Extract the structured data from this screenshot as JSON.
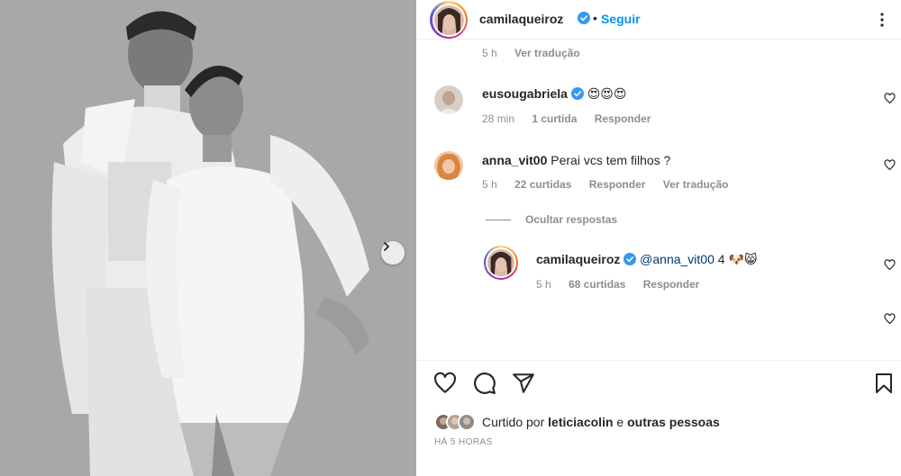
{
  "post": {
    "username": "camilaqueiroz",
    "separator": "•",
    "follow_label": "Seguir"
  },
  "comments": {
    "top_meta": {
      "time": "5 h",
      "translate": "Ver tradução"
    },
    "items": [
      {
        "username": "eusougabriela",
        "text": "😍😍😍",
        "time": "28 min",
        "likes": "1 curtida",
        "reply": "Responder"
      },
      {
        "username": "anna_vit00",
        "text": "Perai vcs tem filhos ?",
        "time": "5 h",
        "likes": "22 curtidas",
        "reply": "Responder",
        "translate": "Ver tradução",
        "hide_replies": "Ocultar respostas",
        "reply_item": {
          "username": "camilaqueiroz",
          "mention": "@anna_vit00",
          "text": "4 🐶😸",
          "time": "5 h",
          "likes": "68 curtidas",
          "reply": "Responder"
        }
      }
    ]
  },
  "footer": {
    "liked_by_prefix": "Curtido por",
    "liked_by_user": "leticiacolin",
    "liked_by_and": "e",
    "liked_by_others": "outras pessoas",
    "time_ago": "HÁ 5 HORAS"
  },
  "colors": {
    "link_blue": "#0095f6",
    "verified_blue": "#3897f0",
    "secondary_text": "#8e8e8e"
  },
  "icons": [
    "heart-icon",
    "comment-icon",
    "share-icon",
    "bookmark-icon",
    "more-icon",
    "chevron-right-icon",
    "verified-badge-icon"
  ]
}
